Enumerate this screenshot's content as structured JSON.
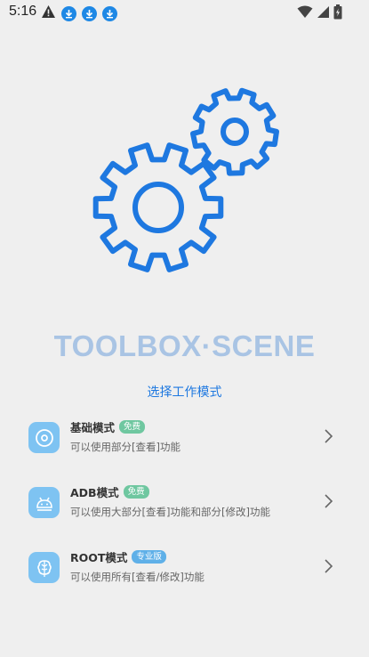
{
  "status_bar": {
    "time": "5:16",
    "left_icons": [
      "warning-icon",
      "download-icon",
      "download-icon",
      "download-icon"
    ],
    "right_icons": [
      "wifi-icon",
      "signal-icon",
      "battery-icon"
    ]
  },
  "app_title": "TOOLBOX·SCENE",
  "subtitle": "选择工作模式",
  "modes": [
    {
      "title": "基础模式",
      "badge": "免费",
      "description": "可以使用部分[查看]功能",
      "icon": "disc-icon"
    },
    {
      "title": "ADB模式",
      "badge": "免费",
      "description": "可以使用大部分[查看]功能和部分[修改]功能",
      "icon": "android-icon"
    },
    {
      "title": "ROOT模式",
      "badge": "专业版",
      "description": "可以使用所有[查看/修改]功能",
      "icon": "brain-icon"
    }
  ],
  "colors": {
    "accent": "#1e78e0",
    "title": "#a9c4e4",
    "icon_bg": "#7ec3f2",
    "badge_free": "#6fc7a0",
    "badge_pro": "#5fb0e8",
    "background": "#efefef"
  }
}
